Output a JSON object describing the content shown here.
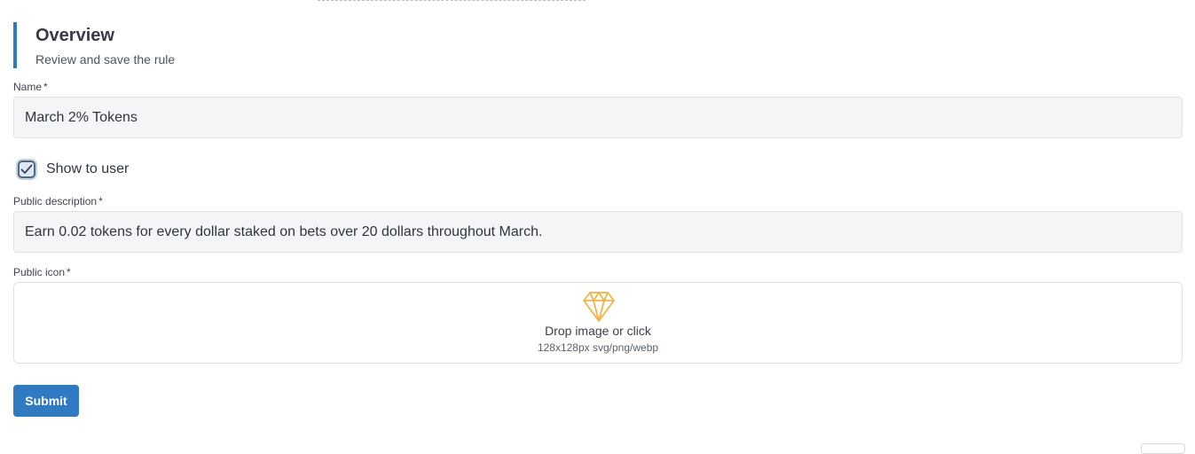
{
  "section": {
    "title": "Overview",
    "subtitle": "Review and save the rule"
  },
  "name_field": {
    "label": "Name",
    "required_mark": "*",
    "value": "March 2% Tokens"
  },
  "show_to_user": {
    "label": "Show to user",
    "checked": true
  },
  "description_field": {
    "label": "Public description",
    "required_mark": "*",
    "value": "Earn 0.02 tokens for every dollar staked on bets over 20 dollars throughout March."
  },
  "icon_field": {
    "label": "Public icon",
    "required_mark": "*",
    "icon": "diamond-icon",
    "prompt": "Drop image or click",
    "hint": "128x128px svg/png/webp"
  },
  "submit": {
    "label": "Submit"
  },
  "colors": {
    "accent": "#2f7ac0",
    "icon": "#f4b343",
    "input_bg": "#f4f5f7"
  }
}
